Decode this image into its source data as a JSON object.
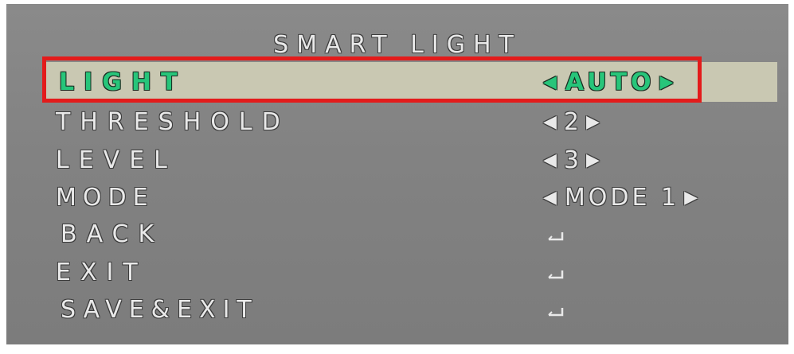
{
  "menu": {
    "title": "SMART LIGHT",
    "items": [
      {
        "label": "LIGHT",
        "value": "AUTO",
        "left_arrow": "◀",
        "right_arrow": "▶",
        "selected": true
      },
      {
        "label": "THRESHOLD",
        "value": "2",
        "left_arrow": "◀",
        "right_arrow": "▶"
      },
      {
        "label": "LEVEL",
        "value": "3",
        "left_arrow": "◀",
        "right_arrow": "▶"
      },
      {
        "label": "MODE",
        "value": "MODE 1",
        "left_arrow": "◀",
        "right_arrow": "▶"
      },
      {
        "label": "BACK",
        "icon": "enter-icon"
      },
      {
        "label": "EXIT",
        "icon": "enter-icon"
      },
      {
        "label": "SAVE&EXIT",
        "icon": "enter-icon"
      }
    ]
  },
  "colors": {
    "selected_text": "#27c57a",
    "highlight_frame": "#e31b1b",
    "selected_bar": "#c9c8b2",
    "background": "#858585"
  }
}
